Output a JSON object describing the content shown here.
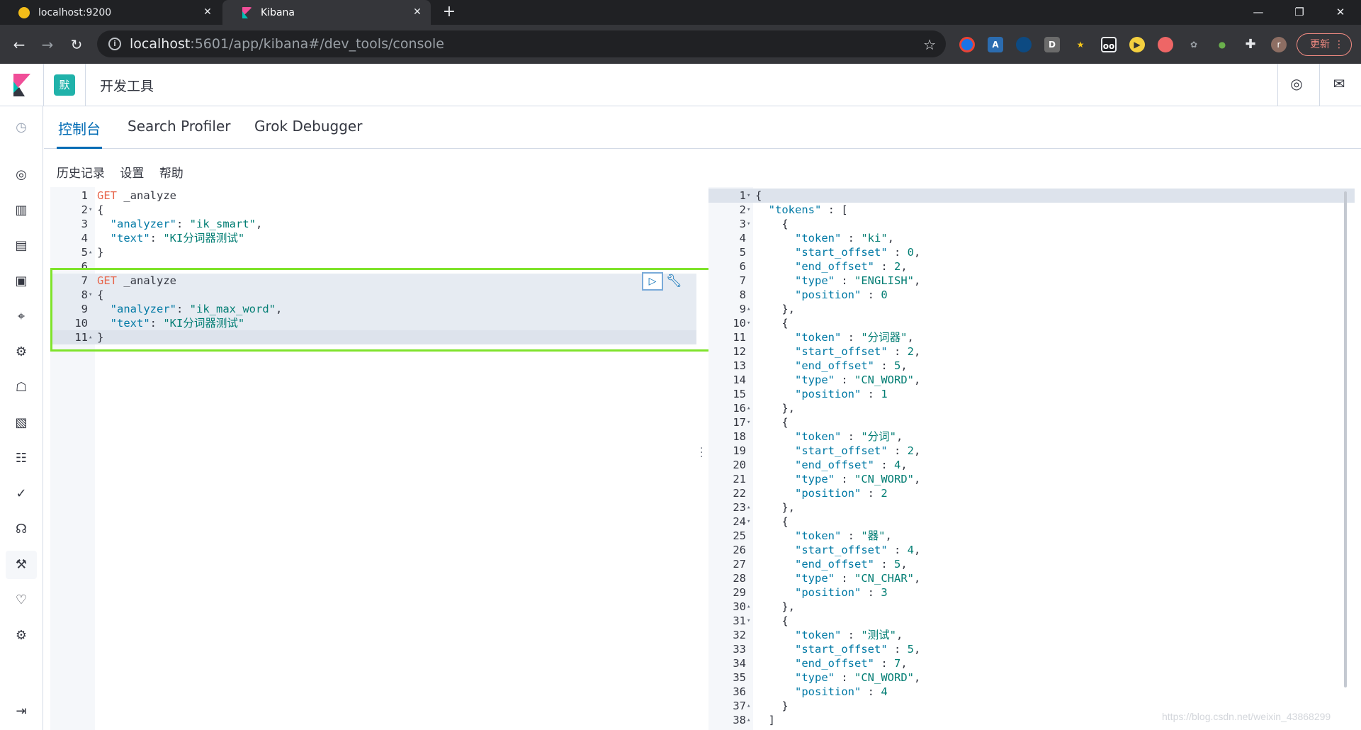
{
  "browser": {
    "tabs": [
      {
        "title": "localhost:9200",
        "active": false
      },
      {
        "title": "Kibana",
        "active": true
      }
    ],
    "url_host": "localhost",
    "url_path": ":5601/app/kibana#/dev_tools/console",
    "update_label": "更新"
  },
  "kibana": {
    "space_initial": "默",
    "app_title": "开发工具",
    "tabs": [
      "控制台",
      "Search Profiler",
      "Grok Debugger"
    ],
    "subnav": [
      "历史记录",
      "设置",
      "帮助"
    ]
  },
  "editor": {
    "lines": [
      {
        "n": "1",
        "fold": "",
        "tokens": [
          [
            "GET",
            "m"
          ],
          [
            " _analyze",
            "u"
          ]
        ]
      },
      {
        "n": "2",
        "fold": "▾",
        "tokens": [
          [
            "{",
            "p"
          ]
        ]
      },
      {
        "n": "3",
        "fold": "",
        "tokens": [
          [
            "  ",
            "p"
          ],
          [
            "\"analyzer\"",
            "k"
          ],
          [
            ": ",
            "p"
          ],
          [
            "\"ik_smart\"",
            "s"
          ],
          [
            ",",
            "p"
          ]
        ]
      },
      {
        "n": "4",
        "fold": "",
        "tokens": [
          [
            "  ",
            "p"
          ],
          [
            "\"text\"",
            "k"
          ],
          [
            ": ",
            "p"
          ],
          [
            "\"KI分词器测试\"",
            "s"
          ]
        ]
      },
      {
        "n": "5",
        "fold": "▴",
        "tokens": [
          [
            "}",
            "p"
          ]
        ]
      },
      {
        "n": "6",
        "fold": "",
        "tokens": []
      },
      {
        "n": "7",
        "fold": "",
        "tokens": [
          [
            "GET",
            "m"
          ],
          [
            " _analyze",
            "u"
          ]
        ],
        "hl": true
      },
      {
        "n": "8",
        "fold": "▾",
        "tokens": [
          [
            "{",
            "p"
          ]
        ],
        "hl": true
      },
      {
        "n": "9",
        "fold": "",
        "tokens": [
          [
            "  ",
            "p"
          ],
          [
            "\"analyzer\"",
            "k"
          ],
          [
            ": ",
            "p"
          ],
          [
            "\"ik_max_word\"",
            "s"
          ],
          [
            ",",
            "p"
          ]
        ],
        "hl": true
      },
      {
        "n": "10",
        "fold": "",
        "tokens": [
          [
            "  ",
            "p"
          ],
          [
            "\"text\"",
            "k"
          ],
          [
            ": ",
            "p"
          ],
          [
            "\"KI分词器测试\"",
            "s"
          ]
        ],
        "hl": true
      },
      {
        "n": "11",
        "fold": "▴",
        "tokens": [
          [
            "}",
            "p"
          ]
        ],
        "cur": true
      }
    ]
  },
  "output": {
    "lines": [
      {
        "n": "1",
        "fold": "▾",
        "tokens": [
          [
            "{",
            "p"
          ]
        ],
        "cur": true
      },
      {
        "n": "2",
        "fold": "▾",
        "tokens": [
          [
            "  ",
            "p"
          ],
          [
            "\"tokens\"",
            "k"
          ],
          [
            " : [",
            "p"
          ]
        ]
      },
      {
        "n": "3",
        "fold": "▾",
        "tokens": [
          [
            "    {",
            "p"
          ]
        ]
      },
      {
        "n": "4",
        "fold": "",
        "tokens": [
          [
            "      ",
            "p"
          ],
          [
            "\"token\"",
            "k"
          ],
          [
            " : ",
            "p"
          ],
          [
            "\"ki\"",
            "s"
          ],
          [
            ",",
            "p"
          ]
        ]
      },
      {
        "n": "5",
        "fold": "",
        "tokens": [
          [
            "      ",
            "p"
          ],
          [
            "\"start_offset\"",
            "k"
          ],
          [
            " : ",
            "p"
          ],
          [
            "0",
            "s"
          ],
          [
            ",",
            "p"
          ]
        ]
      },
      {
        "n": "6",
        "fold": "",
        "tokens": [
          [
            "      ",
            "p"
          ],
          [
            "\"end_offset\"",
            "k"
          ],
          [
            " : ",
            "p"
          ],
          [
            "2",
            "s"
          ],
          [
            ",",
            "p"
          ]
        ]
      },
      {
        "n": "7",
        "fold": "",
        "tokens": [
          [
            "      ",
            "p"
          ],
          [
            "\"type\"",
            "k"
          ],
          [
            " : ",
            "p"
          ],
          [
            "\"ENGLISH\"",
            "s"
          ],
          [
            ",",
            "p"
          ]
        ]
      },
      {
        "n": "8",
        "fold": "",
        "tokens": [
          [
            "      ",
            "p"
          ],
          [
            "\"position\"",
            "k"
          ],
          [
            " : ",
            "p"
          ],
          [
            "0",
            "s"
          ]
        ]
      },
      {
        "n": "9",
        "fold": "▴",
        "tokens": [
          [
            "    },",
            "p"
          ]
        ]
      },
      {
        "n": "10",
        "fold": "▾",
        "tokens": [
          [
            "    {",
            "p"
          ]
        ]
      },
      {
        "n": "11",
        "fold": "",
        "tokens": [
          [
            "      ",
            "p"
          ],
          [
            "\"token\"",
            "k"
          ],
          [
            " : ",
            "p"
          ],
          [
            "\"分词器\"",
            "s"
          ],
          [
            ",",
            "p"
          ]
        ]
      },
      {
        "n": "12",
        "fold": "",
        "tokens": [
          [
            "      ",
            "p"
          ],
          [
            "\"start_offset\"",
            "k"
          ],
          [
            " : ",
            "p"
          ],
          [
            "2",
            "s"
          ],
          [
            ",",
            "p"
          ]
        ]
      },
      {
        "n": "13",
        "fold": "",
        "tokens": [
          [
            "      ",
            "p"
          ],
          [
            "\"end_offset\"",
            "k"
          ],
          [
            " : ",
            "p"
          ],
          [
            "5",
            "s"
          ],
          [
            ",",
            "p"
          ]
        ]
      },
      {
        "n": "14",
        "fold": "",
        "tokens": [
          [
            "      ",
            "p"
          ],
          [
            "\"type\"",
            "k"
          ],
          [
            " : ",
            "p"
          ],
          [
            "\"CN_WORD\"",
            "s"
          ],
          [
            ",",
            "p"
          ]
        ]
      },
      {
        "n": "15",
        "fold": "",
        "tokens": [
          [
            "      ",
            "p"
          ],
          [
            "\"position\"",
            "k"
          ],
          [
            " : ",
            "p"
          ],
          [
            "1",
            "s"
          ]
        ]
      },
      {
        "n": "16",
        "fold": "▴",
        "tokens": [
          [
            "    },",
            "p"
          ]
        ]
      },
      {
        "n": "17",
        "fold": "▾",
        "tokens": [
          [
            "    {",
            "p"
          ]
        ]
      },
      {
        "n": "18",
        "fold": "",
        "tokens": [
          [
            "      ",
            "p"
          ],
          [
            "\"token\"",
            "k"
          ],
          [
            " : ",
            "p"
          ],
          [
            "\"分词\"",
            "s"
          ],
          [
            ",",
            "p"
          ]
        ]
      },
      {
        "n": "19",
        "fold": "",
        "tokens": [
          [
            "      ",
            "p"
          ],
          [
            "\"start_offset\"",
            "k"
          ],
          [
            " : ",
            "p"
          ],
          [
            "2",
            "s"
          ],
          [
            ",",
            "p"
          ]
        ]
      },
      {
        "n": "20",
        "fold": "",
        "tokens": [
          [
            "      ",
            "p"
          ],
          [
            "\"end_offset\"",
            "k"
          ],
          [
            " : ",
            "p"
          ],
          [
            "4",
            "s"
          ],
          [
            ",",
            "p"
          ]
        ]
      },
      {
        "n": "21",
        "fold": "",
        "tokens": [
          [
            "      ",
            "p"
          ],
          [
            "\"type\"",
            "k"
          ],
          [
            " : ",
            "p"
          ],
          [
            "\"CN_WORD\"",
            "s"
          ],
          [
            ",",
            "p"
          ]
        ]
      },
      {
        "n": "22",
        "fold": "",
        "tokens": [
          [
            "      ",
            "p"
          ],
          [
            "\"position\"",
            "k"
          ],
          [
            " : ",
            "p"
          ],
          [
            "2",
            "s"
          ]
        ]
      },
      {
        "n": "23",
        "fold": "▴",
        "tokens": [
          [
            "    },",
            "p"
          ]
        ]
      },
      {
        "n": "24",
        "fold": "▾",
        "tokens": [
          [
            "    {",
            "p"
          ]
        ]
      },
      {
        "n": "25",
        "fold": "",
        "tokens": [
          [
            "      ",
            "p"
          ],
          [
            "\"token\"",
            "k"
          ],
          [
            " : ",
            "p"
          ],
          [
            "\"器\"",
            "s"
          ],
          [
            ",",
            "p"
          ]
        ]
      },
      {
        "n": "26",
        "fold": "",
        "tokens": [
          [
            "      ",
            "p"
          ],
          [
            "\"start_offset\"",
            "k"
          ],
          [
            " : ",
            "p"
          ],
          [
            "4",
            "s"
          ],
          [
            ",",
            "p"
          ]
        ]
      },
      {
        "n": "27",
        "fold": "",
        "tokens": [
          [
            "      ",
            "p"
          ],
          [
            "\"end_offset\"",
            "k"
          ],
          [
            " : ",
            "p"
          ],
          [
            "5",
            "s"
          ],
          [
            ",",
            "p"
          ]
        ]
      },
      {
        "n": "28",
        "fold": "",
        "tokens": [
          [
            "      ",
            "p"
          ],
          [
            "\"type\"",
            "k"
          ],
          [
            " : ",
            "p"
          ],
          [
            "\"CN_CHAR\"",
            "s"
          ],
          [
            ",",
            "p"
          ]
        ]
      },
      {
        "n": "29",
        "fold": "",
        "tokens": [
          [
            "      ",
            "p"
          ],
          [
            "\"position\"",
            "k"
          ],
          [
            " : ",
            "p"
          ],
          [
            "3",
            "s"
          ]
        ]
      },
      {
        "n": "30",
        "fold": "▴",
        "tokens": [
          [
            "    },",
            "p"
          ]
        ]
      },
      {
        "n": "31",
        "fold": "▾",
        "tokens": [
          [
            "    {",
            "p"
          ]
        ]
      },
      {
        "n": "32",
        "fold": "",
        "tokens": [
          [
            "      ",
            "p"
          ],
          [
            "\"token\"",
            "k"
          ],
          [
            " : ",
            "p"
          ],
          [
            "\"测试\"",
            "s"
          ],
          [
            ",",
            "p"
          ]
        ]
      },
      {
        "n": "33",
        "fold": "",
        "tokens": [
          [
            "      ",
            "p"
          ],
          [
            "\"start_offset\"",
            "k"
          ],
          [
            " : ",
            "p"
          ],
          [
            "5",
            "s"
          ],
          [
            ",",
            "p"
          ]
        ]
      },
      {
        "n": "34",
        "fold": "",
        "tokens": [
          [
            "      ",
            "p"
          ],
          [
            "\"end_offset\"",
            "k"
          ],
          [
            " : ",
            "p"
          ],
          [
            "7",
            "s"
          ],
          [
            ",",
            "p"
          ]
        ]
      },
      {
        "n": "35",
        "fold": "",
        "tokens": [
          [
            "      ",
            "p"
          ],
          [
            "\"type\"",
            "k"
          ],
          [
            " : ",
            "p"
          ],
          [
            "\"CN_WORD\"",
            "s"
          ],
          [
            ",",
            "p"
          ]
        ]
      },
      {
        "n": "36",
        "fold": "",
        "tokens": [
          [
            "      ",
            "p"
          ],
          [
            "\"position\"",
            "k"
          ],
          [
            " : ",
            "p"
          ],
          [
            "4",
            "s"
          ]
        ]
      },
      {
        "n": "37",
        "fold": "▴",
        "tokens": [
          [
            "    }",
            "p"
          ]
        ]
      },
      {
        "n": "38",
        "fold": "▴",
        "tokens": [
          [
            "  ]",
            "p"
          ]
        ]
      }
    ]
  },
  "watermark": "https://blog.csdn.net/weixin_43868299",
  "colors": {
    "accent": "#006bb4",
    "highlight_box": "#7fe32b",
    "method": "#e7664c",
    "key": "#0079a5",
    "string": "#017d73"
  }
}
